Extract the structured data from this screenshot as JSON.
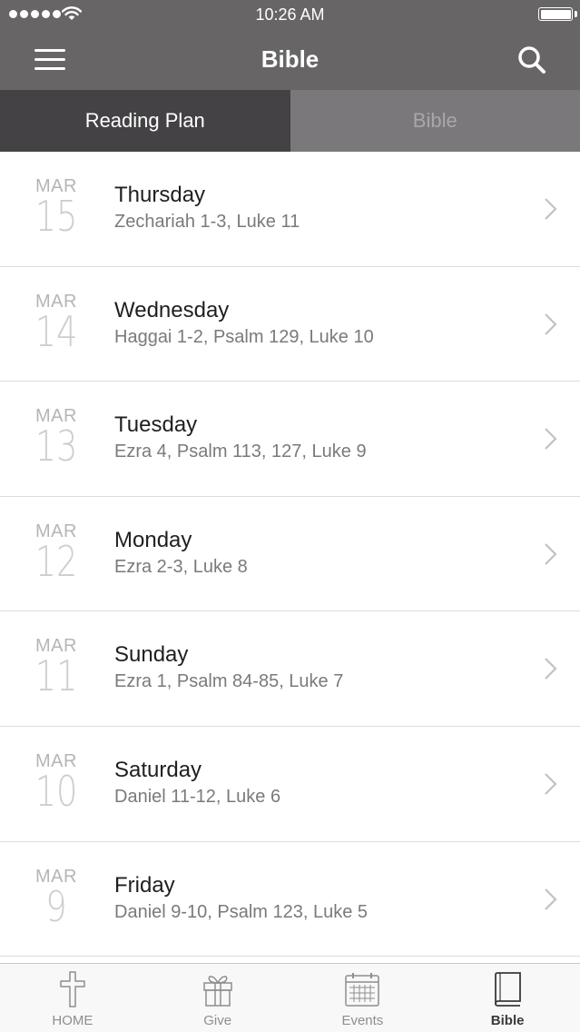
{
  "status": {
    "time": "10:26 AM"
  },
  "navbar": {
    "title": "Bible"
  },
  "segments": [
    {
      "label": "Reading Plan",
      "active": true
    },
    {
      "label": "Bible",
      "active": false
    }
  ],
  "readings": [
    {
      "month": "MAR",
      "day": "15",
      "weekday": "Thursday",
      "passages": "Zechariah 1-3, Luke 11"
    },
    {
      "month": "MAR",
      "day": "14",
      "weekday": "Wednesday",
      "passages": "Haggai 1-2, Psalm 129, Luke 10"
    },
    {
      "month": "MAR",
      "day": "13",
      "weekday": "Tuesday",
      "passages": "Ezra 4, Psalm 113, 127, Luke 9"
    },
    {
      "month": "MAR",
      "day": "12",
      "weekday": "Monday",
      "passages": "Ezra 2-3, Luke 8"
    },
    {
      "month": "MAR",
      "day": "11",
      "weekday": "Sunday",
      "passages": "Ezra 1, Psalm 84-85, Luke 7"
    },
    {
      "month": "MAR",
      "day": "10",
      "weekday": "Saturday",
      "passages": "Daniel 11-12, Luke 6"
    },
    {
      "month": "MAR",
      "day": "9",
      "weekday": "Friday",
      "passages": "Daniel 9-10, Psalm 123, Luke 5"
    }
  ],
  "tabs": [
    {
      "label": "HOME",
      "icon": "cross-icon"
    },
    {
      "label": "Give",
      "icon": "gift-icon"
    },
    {
      "label": "Events",
      "icon": "calendar-icon"
    },
    {
      "label": "Bible",
      "icon": "book-icon",
      "active": true
    }
  ],
  "colors": {
    "header": "#676566",
    "segment_active": "#444244",
    "segment_inactive": "#7a787a"
  }
}
